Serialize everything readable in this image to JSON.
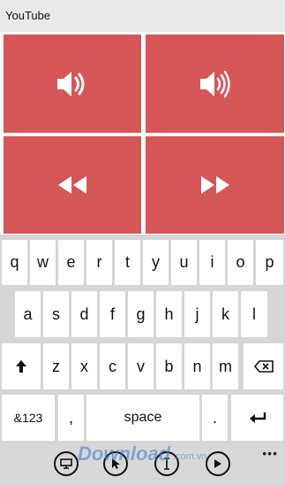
{
  "window": {
    "title": "YouTube"
  },
  "controls": [
    {
      "name": "volume-down",
      "icon": "speaker-low-icon"
    },
    {
      "name": "volume-up",
      "icon": "speaker-high-icon"
    },
    {
      "name": "rewind",
      "icon": "rewind-icon"
    },
    {
      "name": "fast-forward",
      "icon": "fast-forward-icon"
    }
  ],
  "keyboard": {
    "row1": [
      "q",
      "w",
      "e",
      "r",
      "t",
      "y",
      "u",
      "i",
      "o",
      "p"
    ],
    "row2": [
      "a",
      "s",
      "d",
      "f",
      "g",
      "h",
      "j",
      "k",
      "l"
    ],
    "row3": [
      "z",
      "x",
      "c",
      "v",
      "b",
      "n",
      "m"
    ],
    "shift_icon": "shift-arrow-icon",
    "backspace_icon": "backspace-icon",
    "symbols_label": "&123",
    "comma_label": ",",
    "space_label": "space",
    "period_label": ".",
    "enter_icon": "enter-icon"
  },
  "appbar": {
    "buttons": [
      "display-icon",
      "cursor-icon",
      "text-cursor-icon",
      "play-icon"
    ],
    "more_label": "•••"
  },
  "watermark": {
    "text": "Download",
    "sub": ".com.vn"
  },
  "colors": {
    "tile": "#d65658",
    "keyboard_bg": "#d6d6d6",
    "titlebar_bg": "#e9e9e9"
  }
}
